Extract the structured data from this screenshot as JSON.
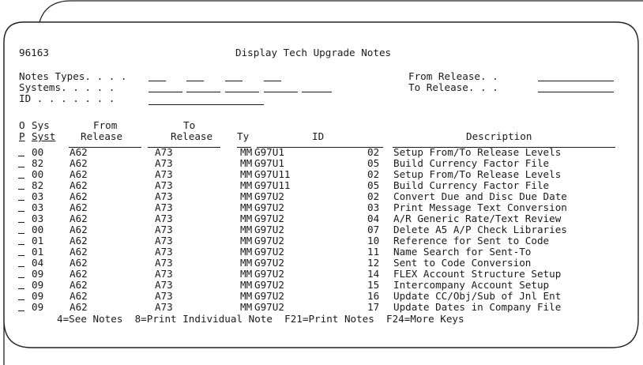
{
  "screen": {
    "program_id": "96163",
    "title": "Display Tech Upgrade Notes"
  },
  "filters": {
    "notes_types_label": "Notes Types. . . .",
    "systems_label": "Systems. . . . .",
    "id_label": "ID . . . . . . .",
    "from_release_label": "From Release. .",
    "to_release_label": "To Release. . ."
  },
  "columns": {
    "option": [
      "O",
      "P"
    ],
    "system": [
      "Sys",
      "Syst"
    ],
    "from_release": [
      "From",
      "Release"
    ],
    "to_release": [
      "To",
      "Release"
    ],
    "type": "Ty",
    "id": "ID",
    "description": "Description"
  },
  "rows": [
    {
      "syst": "00",
      "from": "A62",
      "to": "A73",
      "ty": "MM",
      "id": "G97U1",
      "seq": "02",
      "desc": "Setup From/To Release Levels"
    },
    {
      "syst": "82",
      "from": "A62",
      "to": "A73",
      "ty": "MM",
      "id": "G97U1",
      "seq": "05",
      "desc": "Build Currency Factor File"
    },
    {
      "syst": "00",
      "from": "A62",
      "to": "A73",
      "ty": "MM",
      "id": "G97U11",
      "seq": "02",
      "desc": "Setup From/To Release Levels"
    },
    {
      "syst": "82",
      "from": "A62",
      "to": "A73",
      "ty": "MM",
      "id": "G97U11",
      "seq": "05",
      "desc": "Build Currency Factor File"
    },
    {
      "syst": "03",
      "from": "A62",
      "to": "A73",
      "ty": "MM",
      "id": "G97U2",
      "seq": "02",
      "desc": "Convert Due and Disc Due Date"
    },
    {
      "syst": "03",
      "from": "A62",
      "to": "A73",
      "ty": "MM",
      "id": "G97U2",
      "seq": "03",
      "desc": "Print Message Text Conversion"
    },
    {
      "syst": "03",
      "from": "A62",
      "to": "A73",
      "ty": "MM",
      "id": "G97U2",
      "seq": "04",
      "desc": "A/R Generic Rate/Text Review"
    },
    {
      "syst": "00",
      "from": "A62",
      "to": "A73",
      "ty": "MM",
      "id": "G97U2",
      "seq": "07",
      "desc": "Delete A5 A/P Check Libraries"
    },
    {
      "syst": "01",
      "from": "A62",
      "to": "A73",
      "ty": "MM",
      "id": "G97U2",
      "seq": "10",
      "desc": "Reference for Sent to Code"
    },
    {
      "syst": "01",
      "from": "A62",
      "to": "A73",
      "ty": "MM",
      "id": "G97U2",
      "seq": "11",
      "desc": "Name Search for Sent-To"
    },
    {
      "syst": "04",
      "from": "A62",
      "to": "A73",
      "ty": "MM",
      "id": "G97U2",
      "seq": "12",
      "desc": "Sent to Code Conversion"
    },
    {
      "syst": "09",
      "from": "A62",
      "to": "A73",
      "ty": "MM",
      "id": "G97U2",
      "seq": "14",
      "desc": "FLEX Account Structure Setup"
    },
    {
      "syst": "09",
      "from": "A62",
      "to": "A73",
      "ty": "MM",
      "id": "G97U2",
      "seq": "15",
      "desc": "Intercompany Account Setup"
    },
    {
      "syst": "09",
      "from": "A62",
      "to": "A73",
      "ty": "MM",
      "id": "G97U2",
      "seq": "16",
      "desc": "Update CC/Obj/Sub of Jnl Ent"
    },
    {
      "syst": "09",
      "from": "A62",
      "to": "A73",
      "ty": "MM",
      "id": "G97U2",
      "seq": "17",
      "desc": "Update Dates in Company File"
    }
  ],
  "footer": {
    "keys": "4=See Notes  8=Print Individual Note  F21=Print Notes  F24=More Keys"
  }
}
